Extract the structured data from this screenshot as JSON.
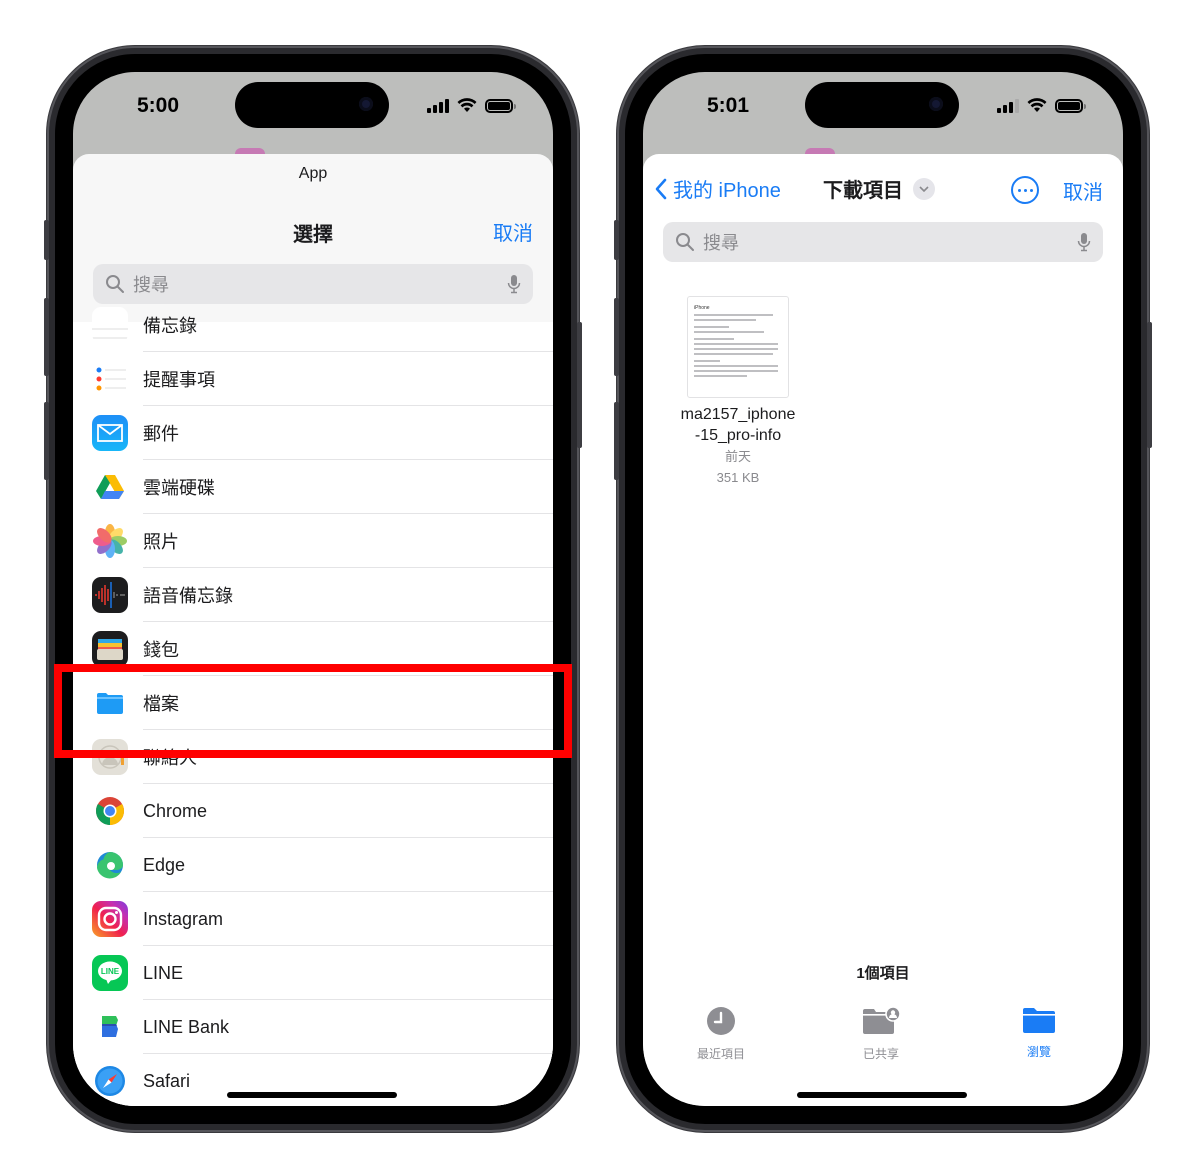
{
  "left_phone": {
    "status": {
      "time": "5:00"
    },
    "sheet": {
      "app_label": "App",
      "title": "選擇",
      "cancel_label": "取消",
      "search_placeholder": "搜尋"
    },
    "apps": [
      {
        "label": "備忘錄",
        "icon": "notes-icon"
      },
      {
        "label": "提醒事項",
        "icon": "reminders-icon"
      },
      {
        "label": "郵件",
        "icon": "mail-icon"
      },
      {
        "label": "雲端硬碟",
        "icon": "google-drive-icon"
      },
      {
        "label": "照片",
        "icon": "photos-icon"
      },
      {
        "label": "語音備忘錄",
        "icon": "voice-memos-icon"
      },
      {
        "label": "錢包",
        "icon": "wallet-icon"
      },
      {
        "label": "檔案",
        "icon": "files-icon",
        "highlighted": true
      },
      {
        "label": "聯絡人",
        "icon": "contacts-icon"
      },
      {
        "label": "Chrome",
        "icon": "chrome-icon"
      },
      {
        "label": "Edge",
        "icon": "edge-icon"
      },
      {
        "label": "Instagram",
        "icon": "instagram-icon"
      },
      {
        "label": "LINE",
        "icon": "line-icon"
      },
      {
        "label": "LINE Bank",
        "icon": "line-bank-icon"
      },
      {
        "label": "Safari",
        "icon": "safari-icon"
      }
    ],
    "highlight_color": "#ff0000"
  },
  "right_phone": {
    "status": {
      "time": "5:01"
    },
    "nav": {
      "back_label": "我的 iPhone",
      "folder_title": "下載項目",
      "cancel_label": "取消"
    },
    "search_placeholder": "搜尋",
    "files": [
      {
        "name": "ma2157_iphone-15_pro-info",
        "name_line1": "ma2157_iphone",
        "name_line2": "-15_pro-info",
        "date": "前天",
        "size": "351 KB",
        "thumb_title": "iPhone"
      }
    ],
    "item_count": "1個項目",
    "tabs": [
      {
        "label": "最近項目",
        "icon": "clock-icon",
        "active": false
      },
      {
        "label": "已共享",
        "icon": "shared-folder-icon",
        "active": false
      },
      {
        "label": "瀏覽",
        "icon": "folder-icon",
        "active": true
      }
    ]
  },
  "colors": {
    "accent": "#1a7cf5",
    "highlight": "#ff0000",
    "inactive": "#8e8e93"
  }
}
